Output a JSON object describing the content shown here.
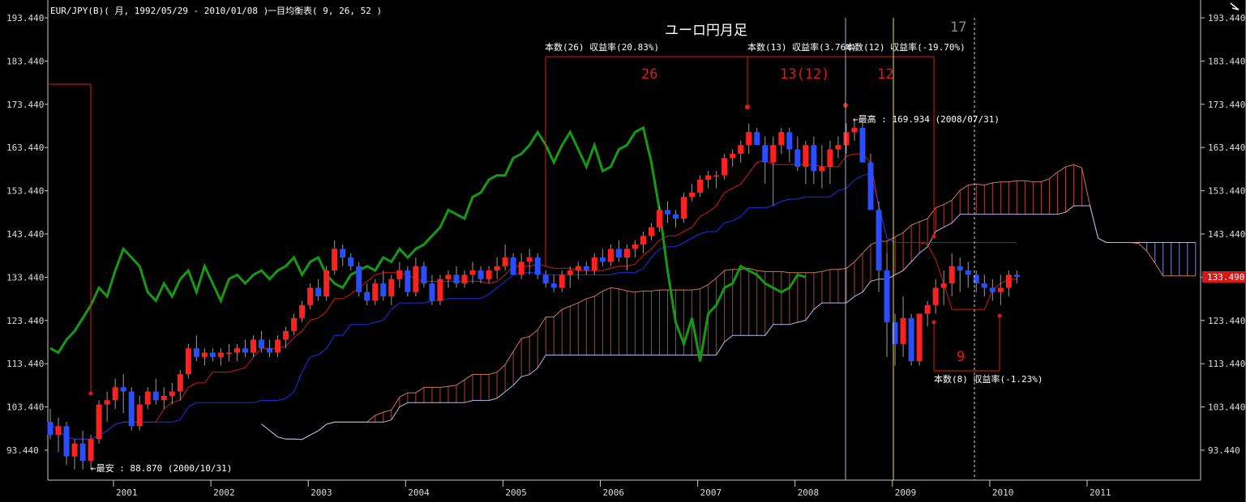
{
  "header": {
    "symbol_text": "EUR/JPY(B)( 月, 1992/05/29 - 2010/01/08 )",
    "indicator_text": "一目均衡表( 9, 26, 52 )",
    "chart_title": "ユーロ円月足"
  },
  "annotations": {
    "count26_label": "本数(26) 収益率(20.83%)",
    "count13_label": "本数(13) 収益率(3.76%)",
    "count12_label": "本数(12) 収益率(-19.70%)",
    "count8_label": "本数(8) 収益率(-1.23%)",
    "big26": "26",
    "big13": "13(12)",
    "big12": "12",
    "big9": "9",
    "big17": "17",
    "high_label": "最高 : 169.934 (2008/07/31)",
    "low_label": "最安 : 88.870 (2000/10/31)",
    "current_price": "133.490"
  },
  "colors": {
    "background": "#000000",
    "up_candle": "#ff2020",
    "down_candle": "#2a4dff",
    "tenkan": "#d01818",
    "kijun": "#1c2ee8",
    "chikou": "#169a16",
    "kumo_bull": "#b04030",
    "kumo_bear": "#7e86d8",
    "annotation": "#e01818",
    "price_tag_bg": "#d81818"
  },
  "chart_data": {
    "type": "candlestick",
    "y_ticks": [
      "193.440",
      "183.440",
      "173.440",
      "163.440",
      "153.440",
      "143.440",
      "133.440",
      "123.440",
      "113.440",
      "103.440",
      "93.440"
    ],
    "x_ticks": [
      "2001",
      "2002",
      "2003",
      "2004",
      "2005",
      "2006",
      "2007",
      "2008",
      "2009",
      "2010",
      "2011"
    ],
    "ylim": [
      86.5,
      196.5
    ],
    "candles": [
      [
        100,
        103,
        96,
        97
      ],
      [
        97,
        101,
        93,
        99
      ],
      [
        99,
        100,
        90,
        92
      ],
      [
        92,
        96,
        89,
        95
      ],
      [
        95,
        98,
        89,
        91
      ],
      [
        91,
        97,
        88.87,
        96
      ],
      [
        96,
        105,
        95,
        104
      ],
      [
        104,
        107,
        100,
        105
      ],
      [
        105,
        110,
        103,
        108
      ],
      [
        108,
        111,
        102,
        107
      ],
      [
        107,
        108,
        98,
        99
      ],
      [
        99,
        106,
        98,
        104
      ],
      [
        104,
        108,
        103,
        107
      ],
      [
        107,
        110,
        104,
        105
      ],
      [
        105,
        108,
        103,
        106
      ],
      [
        106,
        109,
        104,
        107
      ],
      [
        107,
        112,
        105,
        111
      ],
      [
        111,
        118,
        110,
        117
      ],
      [
        117,
        120,
        114,
        115
      ],
      [
        115,
        117,
        113,
        116
      ],
      [
        116,
        117,
        114,
        115
      ],
      [
        115,
        117,
        113,
        116
      ],
      [
        116,
        118,
        114,
        116
      ],
      [
        116,
        118,
        114,
        117
      ],
      [
        117,
        119,
        115,
        116
      ],
      [
        116,
        120,
        115,
        119
      ],
      [
        119,
        121,
        116,
        117
      ],
      [
        117,
        119,
        115,
        116
      ],
      [
        116,
        120,
        115,
        119
      ],
      [
        119,
        122,
        117,
        121
      ],
      [
        121,
        125,
        120,
        124
      ],
      [
        124,
        128,
        123,
        127
      ],
      [
        127,
        132,
        126,
        131
      ],
      [
        131,
        133,
        128,
        129
      ],
      [
        129,
        136,
        128,
        135
      ],
      [
        135,
        142,
        134,
        140
      ],
      [
        140,
        141,
        136,
        138
      ],
      [
        138,
        139,
        135,
        136
      ],
      [
        136,
        137,
        129,
        130
      ],
      [
        130,
        132,
        127,
        128
      ],
      [
        128,
        133,
        127,
        132
      ],
      [
        132,
        135,
        128,
        129
      ],
      [
        129,
        134,
        127,
        133
      ],
      [
        133,
        137,
        131,
        135
      ],
      [
        135,
        136,
        129,
        130
      ],
      [
        130,
        138,
        129,
        136
      ],
      [
        136,
        137,
        131,
        132
      ],
      [
        132,
        134,
        127,
        128
      ],
      [
        128,
        134,
        127,
        133
      ],
      [
        133,
        135,
        131,
        134
      ],
      [
        134,
        136,
        131,
        132
      ],
      [
        132,
        135,
        131,
        134
      ],
      [
        134,
        137,
        132,
        135
      ],
      [
        135,
        136,
        132,
        133
      ],
      [
        133,
        136,
        132,
        135
      ],
      [
        135,
        138,
        133,
        136
      ],
      [
        136,
        141,
        135,
        138
      ],
      [
        138,
        139,
        134,
        134
      ],
      [
        134,
        139,
        133,
        137
      ],
      [
        137,
        140,
        134,
        138
      ],
      [
        138,
        139,
        133,
        134
      ],
      [
        134,
        135,
        131,
        132
      ],
      [
        132,
        134,
        130,
        131
      ],
      [
        131,
        135,
        130,
        134
      ],
      [
        134,
        136,
        131,
        135
      ],
      [
        135,
        137,
        133,
        136
      ],
      [
        136,
        137,
        134,
        135
      ],
      [
        135,
        139,
        134,
        138
      ],
      [
        138,
        140,
        136,
        137
      ],
      [
        137,
        141,
        136,
        140
      ],
      [
        140,
        142,
        137,
        138
      ],
      [
        138,
        141,
        135,
        140
      ],
      [
        140,
        142,
        138,
        141
      ],
      [
        141,
        144,
        139,
        143
      ],
      [
        143,
        146,
        142,
        145
      ],
      [
        145,
        150,
        144,
        149
      ],
      [
        149,
        151,
        146,
        148
      ],
      [
        148,
        149,
        145,
        147
      ],
      [
        147,
        153,
        146,
        152
      ],
      [
        152,
        155,
        151,
        153
      ],
      [
        153,
        157,
        152,
        156
      ],
      [
        156,
        158,
        154,
        157
      ],
      [
        157,
        158,
        154,
        157
      ],
      [
        157,
        162,
        156,
        161
      ],
      [
        161,
        163,
        159,
        162
      ],
      [
        162,
        165,
        160,
        164
      ],
      [
        164,
        169,
        162,
        167
      ],
      [
        167,
        168,
        164,
        164
      ],
      [
        164,
        166,
        155,
        160
      ],
      [
        160,
        166,
        150,
        164
      ],
      [
        164,
        168,
        162,
        167
      ],
      [
        167,
        168,
        160,
        163
      ],
      [
        163,
        166,
        158,
        159
      ],
      [
        159,
        165,
        155,
        164
      ],
      [
        164,
        166,
        155,
        158
      ],
      [
        158,
        164,
        154,
        159
      ],
      [
        159,
        165,
        155,
        163
      ],
      [
        163,
        166,
        161,
        164
      ],
      [
        164,
        169,
        162,
        167
      ],
      [
        167,
        169.934,
        165,
        168
      ],
      [
        168,
        169,
        160,
        160
      ],
      [
        160,
        162,
        150,
        149
      ],
      [
        149,
        151,
        130,
        135
      ],
      [
        135,
        139,
        115,
        123
      ],
      [
        123,
        125,
        113,
        118
      ],
      [
        118,
        129,
        115,
        124
      ],
      [
        124,
        125,
        113,
        114
      ],
      [
        114,
        125,
        113,
        125
      ],
      [
        125,
        128,
        122,
        127
      ],
      [
        127,
        133,
        125,
        131
      ],
      [
        131,
        135,
        127,
        132
      ],
      [
        132,
        139,
        129,
        136
      ],
      [
        136,
        138,
        130,
        135
      ],
      [
        135,
        137,
        131,
        134
      ],
      [
        134,
        135,
        130,
        132
      ],
      [
        132,
        134,
        129,
        131
      ],
      [
        131,
        133,
        128,
        130
      ],
      [
        130,
        134,
        127,
        131
      ],
      [
        131,
        135,
        129,
        134
      ],
      [
        134,
        135,
        132,
        133.49
      ]
    ]
  }
}
